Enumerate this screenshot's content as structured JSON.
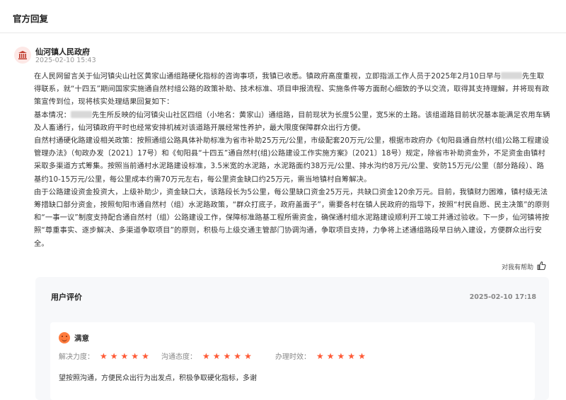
{
  "header": {
    "title": "官方回复"
  },
  "org": {
    "name": "仙河镇人民政府",
    "date": "2025-02-10 15:43",
    "icon": "government-building-icon",
    "accent": "#c0392b"
  },
  "reply": {
    "p1a": "在人民网留言关于仙河镇尖山社区黄家山通组路硬化指标的咨询事项，我镇已收悉。镇政府高度重视，立即指派工作人员于2025年2月10日早与",
    "p1b": "先生取得联系，就“十四五”期间国家实施通自然村组公路的政策补助、技术标准、项目申报流程、实施条件等方面耐心细致的予以交流，取得其支持理解，并将现有政策宣传到位，现将核实处理结果回复如下：",
    "p2a": "基本情况：",
    "p2b": "先生所反映的仙河镇尖山社区四组（小地名：黄家山）通组路，目前现状为长度5公里，宽5米的土路。该组道路目前状况基本能满足农用车辆及人畜通行，仙河镇政府平时也经常安排机械对该道路开展经常性养护，最大限度保障群众出行方便。",
    "p3": "自然村通硬化路建设相关政策：按照通组公路具体补助标准为省市补助25万元/公里，市级配套20万元/公里，根据市政府办《旬阳县通自然村(组)公路工程建设管理办法》（旬政办发〔2021〕17号）和《旬阳县“十四五”通自然村(组)公路建设工作实施方案》〔2021〕18号）规定，除省市补助资金外，不足资金由镇村采取多渠道方式筹集。按照当前通村水泥路建设标准，3.5米宽的水泥路，水泥路面约38万元/公里、排水沟约8万元/公里、安防15万元/公里（部分路段）、路基约10-15万元/公里，每公里成本约需70万元左右，每公里资金缺口约25万元，需当地镇村自筹解决。",
    "p4": "由于公路建设资金投资大，上级补助少，资金缺口大，该路段长为5公里，每公里缺口资金25万元，共缺口资金120余万元。目前，我镇财力困难，镇村级无法筹措缺口部分资金，按照旬阳市通自然村（组）水泥路政策，“群众打底子，政府盖面子”，需要各村在镇人民政府的指导下，按照“村民自愿、民主决策”的原则和“一事一议”制度支持配合通自然村（组）公路建设工作，保障标准路基工程所需资金，确保通村组水泥路建设顺利开工竣工并通过验收。下一步，仙河镇将按照“尊重事实、逐步解决、多渠道争取项目”的原则，积极与上级交通主管部门协调沟通，争取项目支持，力争将上述通组路段早日纳入建设，方便群众出行安全。"
  },
  "helpful": {
    "label": "对我有帮助",
    "icon": "thumbs-up-icon"
  },
  "evaluation": {
    "title": "用户评价",
    "date": "2025-02-10 17:18",
    "satisfaction": {
      "label": "满意",
      "icon": "smiley-face-icon",
      "color": "#ff7b3d"
    },
    "ratings": [
      {
        "label": "解决力度：",
        "stars": 5
      },
      {
        "label": "沟通态度：",
        "stars": 5
      },
      {
        "label": "办理时效：",
        "stars": 5
      }
    ],
    "star_color": "#ff5a36",
    "comment": "望按照沟通，方便民众出行为出发点，积极争取硬化指标，多谢"
  }
}
